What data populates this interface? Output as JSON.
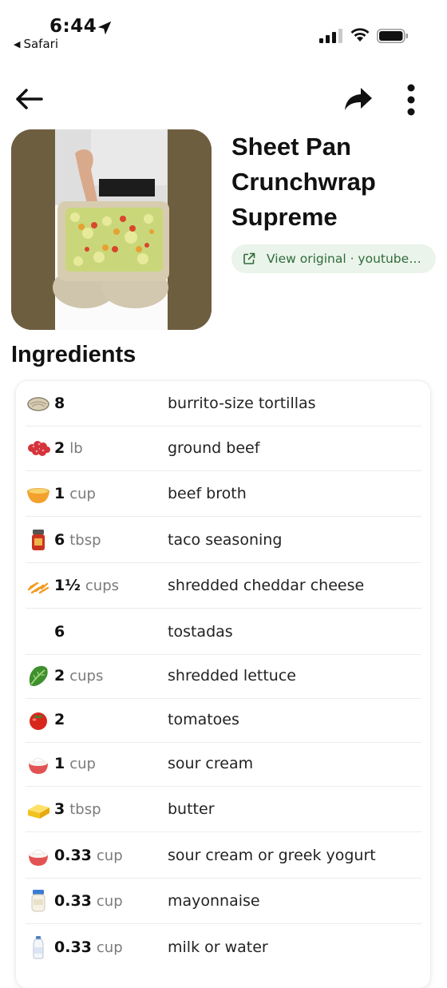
{
  "status_bar": {
    "time": "6:44",
    "back_app": "Safari"
  },
  "recipe": {
    "title": "Sheet Pan Crunchwrap Supreme",
    "source_label": "View original · youtube.com"
  },
  "section_title": "Ingredients",
  "ingredients": [
    {
      "qty": "8",
      "unit": "",
      "name": "burrito-size tortillas",
      "icon": "tortilla-icon"
    },
    {
      "qty": "2",
      "unit": "lb",
      "name": "ground beef",
      "icon": "ground-beef-icon"
    },
    {
      "qty": "1",
      "unit": "cup",
      "name": "beef broth",
      "icon": "broth-bowl-icon"
    },
    {
      "qty": "6",
      "unit": "tbsp",
      "name": "taco seasoning",
      "icon": "spice-jar-icon"
    },
    {
      "qty": "1½",
      "unit": "cups",
      "name": "shredded cheddar cheese",
      "icon": "shredded-cheese-icon"
    },
    {
      "qty": "6",
      "unit": "",
      "name": "tostadas",
      "icon": ""
    },
    {
      "qty": "2",
      "unit": "cups",
      "name": "shredded lettuce",
      "icon": "lettuce-icon"
    },
    {
      "qty": "2",
      "unit": "",
      "name": "tomatoes",
      "icon": "tomato-icon"
    },
    {
      "qty": "1",
      "unit": "cup",
      "name": "sour cream",
      "icon": "sour-cream-icon"
    },
    {
      "qty": "3",
      "unit": "tbsp",
      "name": "butter",
      "icon": "butter-icon"
    },
    {
      "qty": "0.33",
      "unit": "cup",
      "name": "sour cream or greek yogurt",
      "icon": "sour-cream-icon"
    },
    {
      "qty": "0.33",
      "unit": "cup",
      "name": "mayonnaise",
      "icon": "mayonnaise-jar-icon"
    },
    {
      "qty": "0.33",
      "unit": "cup",
      "name": "milk or water",
      "icon": "milk-bottle-icon"
    }
  ],
  "colors": {
    "chip_bg": "#eaf4ea",
    "chip_text": "#2f6b3a",
    "unit_text": "#7b7b7b"
  }
}
